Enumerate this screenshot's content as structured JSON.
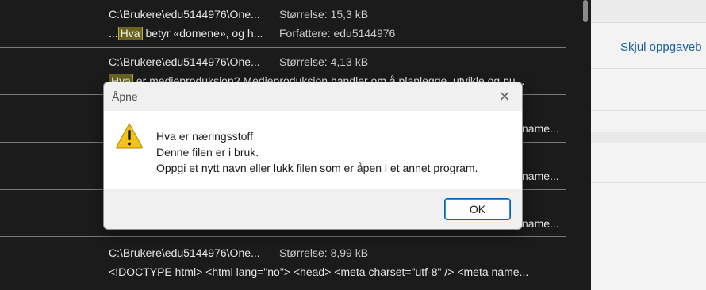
{
  "results": [
    {
      "path": "C:\\Brukere\\edu5144976\\One...",
      "size": "Størrelse: 15,3 kB",
      "snippet_pre": "...",
      "snippet_hl": "Hva",
      "snippet_post": " betyr «domene», og h...",
      "meta2": "Forfattere: edu5144976"
    },
    {
      "path": "C:\\Brukere\\edu5144976\\One...",
      "size": "Størrelse: 4,13 kB",
      "snippet_pre": "",
      "snippet_hl": "Hva",
      "snippet_post": " er medieproduksjon? Medieproduksjon handler om å planlegge, utvikle og pu...",
      "meta2": ""
    },
    {
      "cut": "name..."
    },
    {
      "cut": "name..."
    },
    {
      "cut": "name..."
    },
    {
      "path": "C:\\Brukere\\edu5144976\\One...",
      "size": "Størrelse: 8,99 kB",
      "snippet": "<!DOCTYPE html> <html lang=\"no\"> <head> <meta charset=\"utf-8\" /> <meta name..."
    }
  ],
  "right_panel": {
    "link": "Skjul oppgaveb"
  },
  "dialog": {
    "title": "Åpne",
    "close_glyph": "✕",
    "line1": "Hva er næringsstoff",
    "line2": "Denne filen er i bruk.",
    "line3": "Oppgi et nytt navn eller lukk filen som er åpen i et annet program.",
    "ok_label": "OK",
    "icon": "warning-icon"
  },
  "colors": {
    "accent": "#0067c0",
    "highlight": "#6b6320",
    "link": "#1a5da8"
  }
}
